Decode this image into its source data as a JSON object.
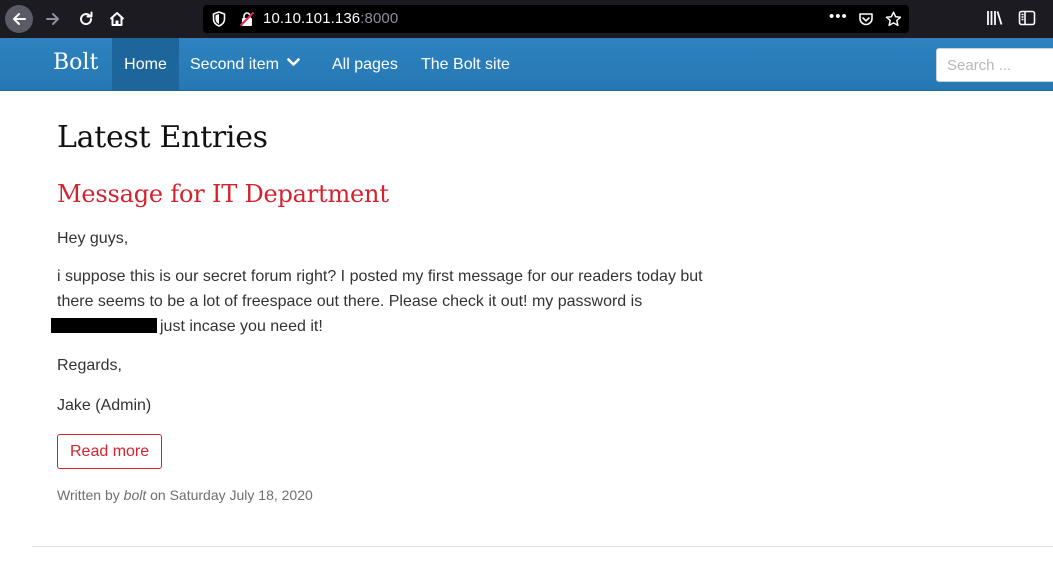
{
  "browser": {
    "url_host": "10.10.101.136",
    "url_port": ":8000",
    "more_label": "•••"
  },
  "site": {
    "brand": "Bolt",
    "nav": {
      "home": "Home",
      "second_item": "Second item",
      "all_pages": "All pages",
      "bolt_site": "The Bolt site"
    },
    "search_placeholder": "Search ..."
  },
  "content": {
    "page_title": "Latest Entries",
    "entry": {
      "title": "Message for IT Department",
      "greeting": "Hey guys,",
      "body_before": "i suppose this is our secret forum right? I posted my first message for our readers today but there seems to be a lot of freespace out there. Please check it out! my password is",
      "body_after": "just incase you need it!",
      "regards": "Regards,",
      "signature": "Jake (Admin)",
      "read_more": "Read more",
      "meta_prefix": "Written by",
      "meta_author": "bolt",
      "meta_date": "on Saturday July 18, 2020"
    }
  },
  "colors": {
    "navbar": "#2578b3",
    "nav_active": "#1d669c",
    "accent_red": "#d3232f",
    "browser_chrome": "#1c1b22"
  },
  "icons": {
    "back": "back-arrow-icon",
    "forward": "forward-arrow-icon",
    "reload": "reload-icon",
    "home": "home-icon",
    "tracking": "shield-icon",
    "insecure": "insecure-lock-icon",
    "pocket": "pocket-icon",
    "bookmark": "star-icon",
    "library": "library-icon",
    "sidebar": "sidebar-icon",
    "dropdown": "chevron-down-icon"
  }
}
